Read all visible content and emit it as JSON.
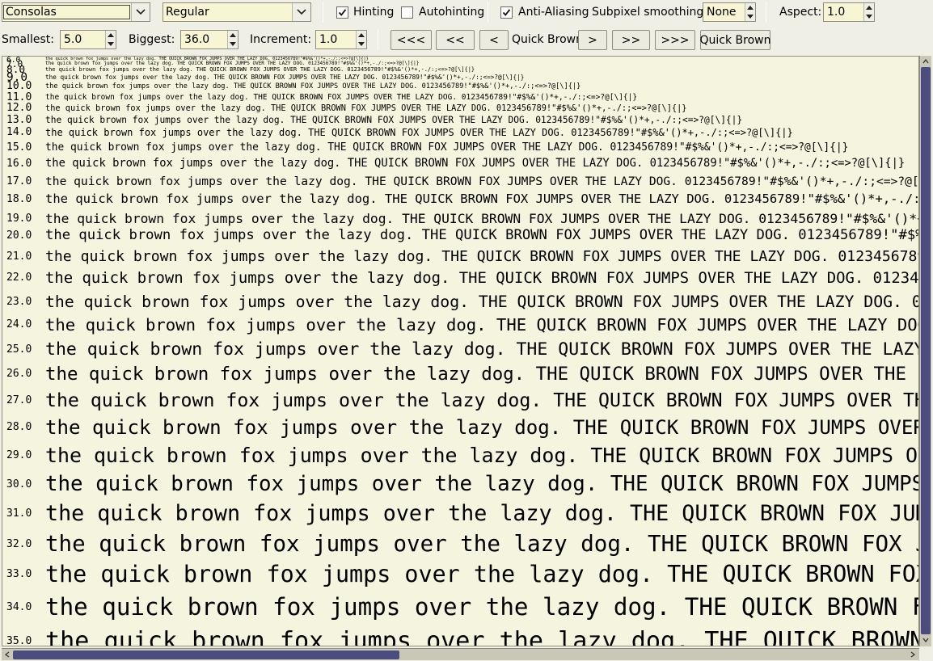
{
  "toolbar1": {
    "font_family": "Consolas",
    "font_style": "Regular",
    "hinting_label": "Hinting",
    "hinting_checked": true,
    "autohinting_label": "Autohinting",
    "autohinting_checked": false,
    "antialiasing_label": "Anti-Aliasing",
    "antialiasing_checked": true,
    "subpixel_label": "Subpixel smoothing:",
    "subpixel_value": "None",
    "aspect_label": "Aspect:",
    "aspect_value": "1.0"
  },
  "toolbar2": {
    "smallest_label": "Smallest:",
    "smallest_value": "5.0",
    "biggest_label": "Biggest:",
    "biggest_value": "36.0",
    "increment_label": "Increment:",
    "increment_value": "1.0",
    "nav_first": "<<<",
    "nav_prev_big": "<<",
    "nav_prev": "<",
    "sample_name": "Quick Brown",
    "nav_next": ">",
    "nav_next_big": ">>",
    "nav_last": ">>>",
    "sample_button": "Quick Brown"
  },
  "preview": {
    "sample_text": "the quick brown fox jumps over the lazy dog. THE QUICK BROWN FOX JUMPS OVER THE LAZY DOG. 0123456789!\"#$%&'()*+,-./:;<=>?@[\\]{|}",
    "rows": [
      {
        "size": "6.0"
      },
      {
        "size": "7.0"
      },
      {
        "size": "8.0"
      },
      {
        "size": "9.0"
      },
      {
        "size": "10.0"
      },
      {
        "size": "11.0"
      },
      {
        "size": "12.0"
      },
      {
        "size": "13.0"
      },
      {
        "size": "14.0"
      },
      {
        "size": "15.0"
      },
      {
        "size": "16.0"
      },
      {
        "size": "17.0"
      },
      {
        "size": "18.0"
      },
      {
        "size": "19.0"
      },
      {
        "size": "20.0"
      },
      {
        "size": "21.0"
      },
      {
        "size": "22.0"
      },
      {
        "size": "23.0"
      },
      {
        "size": "24.0"
      },
      {
        "size": "25.0"
      },
      {
        "size": "26.0"
      },
      {
        "size": "27.0"
      },
      {
        "size": "28.0"
      },
      {
        "size": "29.0"
      },
      {
        "size": "30.0"
      },
      {
        "size": "31.0"
      },
      {
        "size": "32.0"
      },
      {
        "size": "33.0"
      },
      {
        "size": "34.0"
      },
      {
        "size": "35.0"
      }
    ]
  },
  "colors": {
    "window_bg": "#f0efe6",
    "field_bg": "#f7f5d3",
    "preview_bg": "#f5f4de",
    "scrollbar_thumb": "#4a4d7e"
  }
}
